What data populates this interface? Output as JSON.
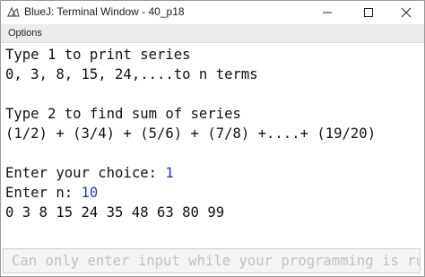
{
  "window": {
    "title": "BlueJ: Terminal Window - 40_p18"
  },
  "menubar": {
    "options_label": "Options"
  },
  "terminal": {
    "lines": [
      "Type 1 to print series",
      "0, 3, 8, 15, 24,....to n terms",
      "",
      "Type 2 to find sum of series",
      "(1/2) + (3/4) + (5/6) + (7/8) +....+ (19/20)",
      "",
      "Enter your choice: ",
      "Enter n: ",
      "0 3 8 15 24 35 48 63 80 99"
    ],
    "choice_value": "1",
    "n_value": "10"
  },
  "input": {
    "placeholder": "Can only enter input while your programming is running"
  },
  "colors": {
    "user_input": "#1f3fb0",
    "menubar_bg": "#ececec",
    "text": "#111111"
  },
  "icons": {
    "app": "bluej-bird-icon",
    "minimize": "minimize-icon",
    "maximize": "maximize-icon",
    "close": "close-icon"
  }
}
